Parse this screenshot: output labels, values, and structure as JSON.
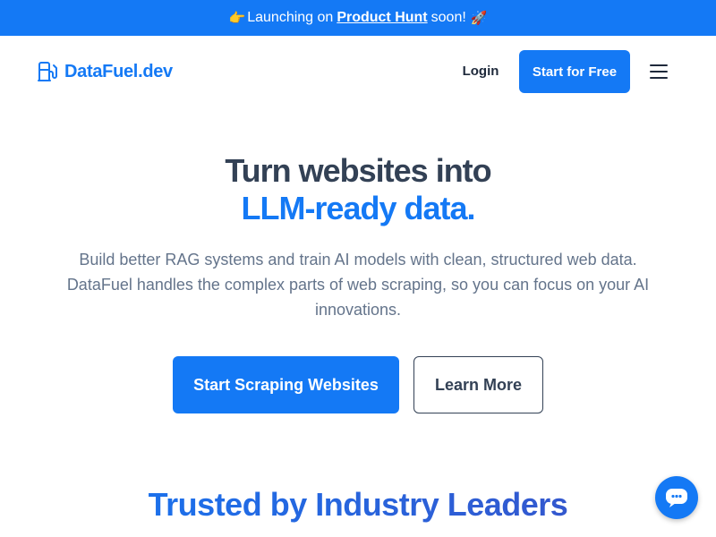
{
  "banner": {
    "leading_emoji": "👉",
    "prefix": "Launching on",
    "link": "Product Hunt",
    "suffix": "soon!",
    "trailing_emoji": "🚀"
  },
  "header": {
    "logo_text": "DataFuel.dev",
    "logo_icon": "fuel-pump-icon",
    "login_label": "Login",
    "cta_label": "Start for Free",
    "menu_icon": "hamburger-menu-icon"
  },
  "hero": {
    "title_line1": "Turn websites into",
    "title_line2": "LLM-ready data.",
    "description": "Build better RAG systems and train AI models with clean, structured web data. DataFuel handles the complex parts of web scraping, so you can focus on your AI innovations.",
    "primary_button": "Start Scraping Websites",
    "secondary_button": "Learn More"
  },
  "section": {
    "title": "Trusted by Industry Leaders"
  },
  "chat": {
    "icon": "chat-bubble-icon"
  },
  "colors": {
    "brand": "#1479f5",
    "heading": "#334155",
    "body_text": "#64748b"
  }
}
